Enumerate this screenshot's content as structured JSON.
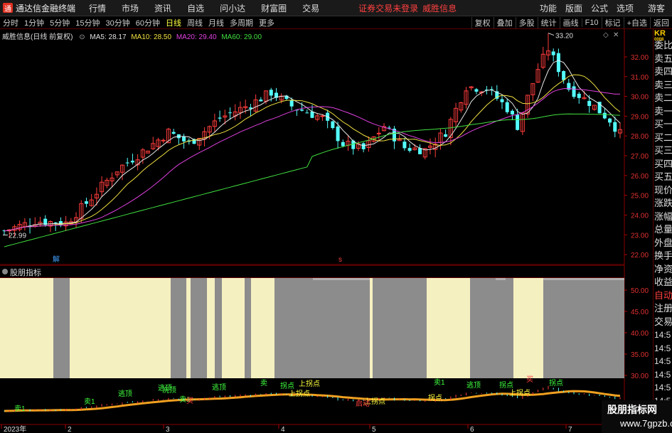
{
  "app": {
    "title": "通达信金融终端",
    "logo_glyph": "通"
  },
  "menu": [
    "行情",
    "市场",
    "资讯",
    "自选",
    "问小达",
    "财富圈",
    "交易"
  ],
  "notice": {
    "trade_status": "证券交易未登录",
    "stock_name": "威胜信息"
  },
  "right_menu": [
    "功能",
    "版面",
    "公式",
    "选项"
  ],
  "guest_label": "游客",
  "periods": [
    "分时",
    "1分钟",
    "5分钟",
    "15分钟",
    "30分钟",
    "60分钟",
    "日线",
    "周线",
    "月线",
    "多周期",
    "更多"
  ],
  "active_period": "日线",
  "toolbar_right": [
    "复权",
    "叠加",
    "多股",
    "统计",
    "画线",
    "F10",
    "标记",
    "+自选",
    "返回"
  ],
  "legend": {
    "name": "威胜信息(日线 前复权)",
    "ma5": "MA5: 28.17",
    "ma10": "MA10: 28.50",
    "ma20": "MA20: 29.40",
    "ma60": "MA60: 29.00"
  },
  "price_axis": [
    "32.00",
    "31.00",
    "30.00",
    "29.00",
    "28.00",
    "27.00",
    "26.00",
    "25.00",
    "24.00",
    "23.00",
    "22.00"
  ],
  "high_label": "33.20",
  "low_label": "22.99",
  "marker_jie": "解",
  "marker_s": "s",
  "indicator": {
    "title": "股朋指标",
    "axis": [
      "50.00",
      "45.00",
      "40.00",
      "35.00",
      "30.00"
    ],
    "labels_green": [
      "卖1",
      "卖1",
      "逃顶",
      "逃顶",
      "卖1",
      "逃顶",
      "洗顶",
      "卖",
      "拐点",
      "卖1",
      "逃顶",
      "拐点",
      "拐点"
    ],
    "labels_yellow": [
      "上拐点",
      "上拐点",
      "上拐点",
      "拐点",
      "上拐点"
    ],
    "labels_red": [
      "买",
      "启动",
      "买"
    ]
  },
  "date_axis": [
    "2023年",
    "2",
    "3",
    "4",
    "5",
    "6",
    "7"
  ],
  "right_panel": {
    "code": "KR",
    "code_small": "0008",
    "items": [
      "委比",
      "卖五",
      "卖四",
      "卖三",
      "卖二",
      "卖一",
      "买一",
      "买二",
      "买三",
      "买四",
      "买五",
      "现价",
      "涨跌",
      "涨幅",
      "总量",
      "外盘",
      "换手",
      "净资",
      "收益"
    ],
    "auto_label": "自动",
    "items2": [
      "注册",
      "交易"
    ],
    "times": [
      "14:5",
      "14:5",
      "14:5",
      "14:5",
      "14:5",
      "14:5",
      "14:5",
      "14:5",
      "14:5"
    ]
  },
  "watermark": {
    "line1": "股朋指标网",
    "line2": "www.7gpzb.com"
  },
  "chart_data": {
    "type": "candlestick",
    "title": "威胜信息(日线 前复权)",
    "ylim": [
      21.5,
      33.4
    ],
    "y_ticks": [
      22,
      23,
      24,
      25,
      26,
      27,
      28,
      29,
      30,
      31,
      32
    ],
    "high": 33.2,
    "low": 22.99,
    "ma": {
      "MA5": 28.17,
      "MA10": 28.5,
      "MA20": 29.4,
      "MA60": 29.0
    },
    "x_labels": [
      "2023年",
      "2",
      "3",
      "4",
      "5",
      "6",
      "7"
    ],
    "indicator_ylim": [
      28,
      53
    ],
    "indicator_ticks": [
      30,
      35,
      40,
      45,
      50
    ]
  }
}
